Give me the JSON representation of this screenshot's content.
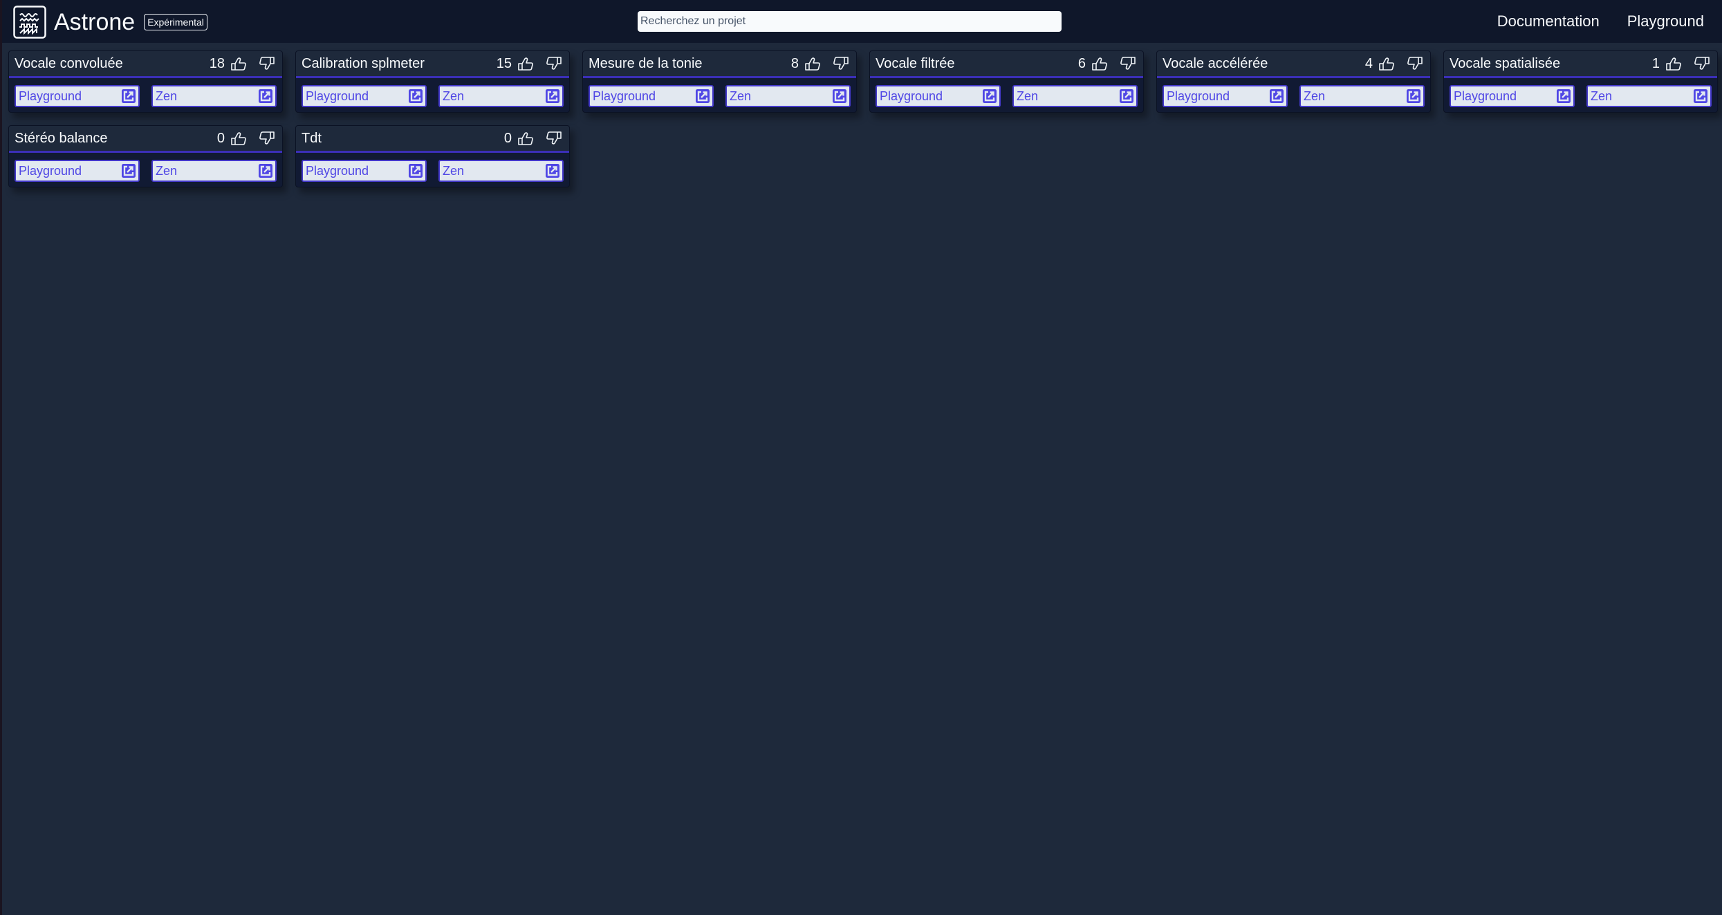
{
  "header": {
    "app_title": "Astrone",
    "badge": "Expérimental",
    "logo_icon": "waveforms-logo-icon",
    "search": {
      "placeholder": "Recherchez un projet",
      "value": ""
    },
    "nav": [
      {
        "label": "Documentation"
      },
      {
        "label": "Playground"
      }
    ]
  },
  "colors": {
    "page_bg": "#1e293b",
    "header_bg": "#0f172a",
    "accent": "#4338ca",
    "link_text": "#4f46e5",
    "button_bg": "#e2e8f0"
  },
  "icons": {
    "vote_up": "thumbs-up-icon",
    "vote_down": "thumbs-down-icon",
    "external": "external-link-icon"
  },
  "projects": [
    {
      "title": "Vocale convoluée",
      "votes": "18",
      "links": [
        {
          "label": "Playground"
        },
        {
          "label": "Zen"
        }
      ]
    },
    {
      "title": "Calibration splmeter",
      "votes": "15",
      "links": [
        {
          "label": "Playground"
        },
        {
          "label": "Zen"
        }
      ]
    },
    {
      "title": "Mesure de la tonie",
      "votes": "8",
      "links": [
        {
          "label": "Playground"
        },
        {
          "label": "Zen"
        }
      ]
    },
    {
      "title": "Vocale filtrée",
      "votes": "6",
      "links": [
        {
          "label": "Playground"
        },
        {
          "label": "Zen"
        }
      ]
    },
    {
      "title": "Vocale accélérée",
      "votes": "4",
      "links": [
        {
          "label": "Playground"
        },
        {
          "label": "Zen"
        }
      ]
    },
    {
      "title": "Vocale spatialisée",
      "votes": "1",
      "links": [
        {
          "label": "Playground"
        },
        {
          "label": "Zen"
        }
      ]
    },
    {
      "title": "Stéréo balance",
      "votes": "0",
      "links": [
        {
          "label": "Playground"
        },
        {
          "label": "Zen"
        }
      ]
    },
    {
      "title": "Tdt",
      "votes": "0",
      "links": [
        {
          "label": "Playground"
        },
        {
          "label": "Zen"
        }
      ]
    }
  ]
}
